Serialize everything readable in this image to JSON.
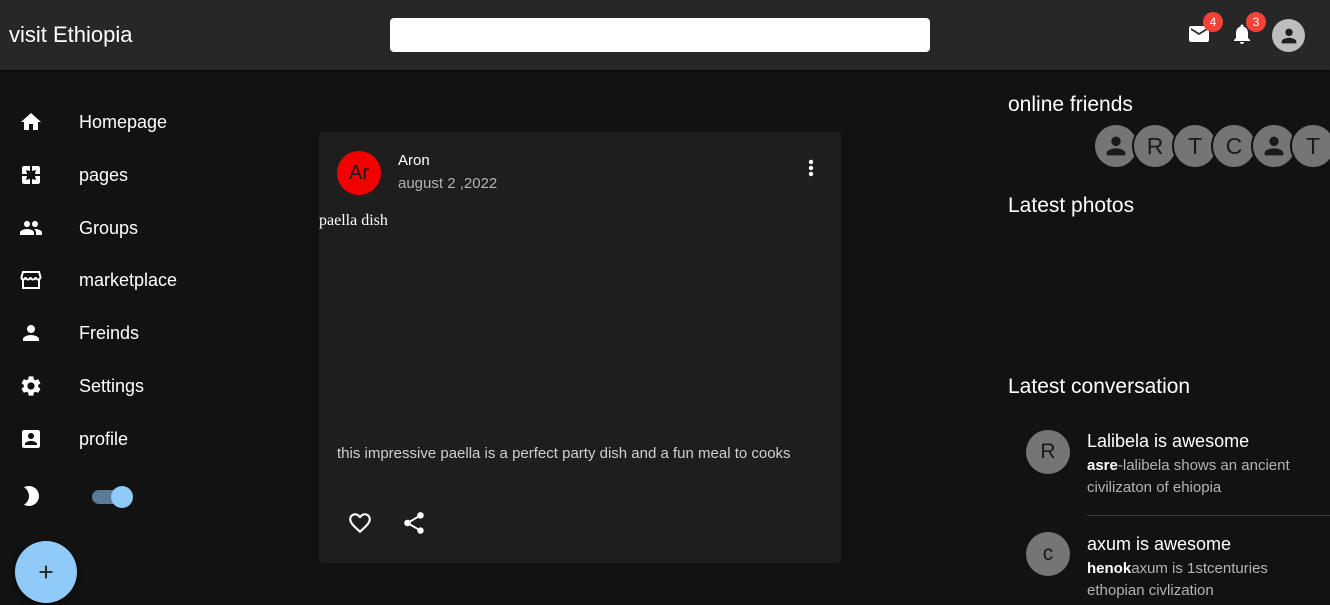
{
  "app": {
    "title": "visit Ethiopia"
  },
  "search": {
    "placeholder": ""
  },
  "header": {
    "mail_count": "4",
    "notif_count": "3"
  },
  "sidebar": {
    "items": [
      {
        "label": "Homepage",
        "icon": "home-icon"
      },
      {
        "label": "pages",
        "icon": "pages-icon"
      },
      {
        "label": "Groups",
        "icon": "groups-icon"
      },
      {
        "label": "marketplace",
        "icon": "storefront-icon"
      },
      {
        "label": "Freinds",
        "icon": "person-icon"
      },
      {
        "label": "Settings",
        "icon": "gear-icon"
      },
      {
        "label": "profile",
        "icon": "account-box-icon"
      }
    ],
    "dark_mode_on": true
  },
  "post": {
    "avatar_initials": "Ar",
    "author": "Aron",
    "date": "august 2 ,2022",
    "image_alt": "paella dish",
    "text": "this impressive paella is a perfect party dish and a fun meal to cooks"
  },
  "right": {
    "online_title": "online friends",
    "friends": [
      "",
      "R",
      "T",
      "C",
      "",
      "T"
    ],
    "photos_title": "Latest photos",
    "conv_title": "Latest conversation",
    "conversations": [
      {
        "initial": "R",
        "title": "Lalibela is awesome",
        "sender": "asre",
        "message": "-lalibela shows an ancient civilizaton of ehiopia"
      },
      {
        "initial": "c",
        "title": "axum is awesome",
        "sender": "henok",
        "message": "axum is 1stcenturies ethopian civlization"
      }
    ]
  },
  "colors": {
    "accent": "#90caf9",
    "badge": "#f44336",
    "avatar_red": "#f20000"
  }
}
